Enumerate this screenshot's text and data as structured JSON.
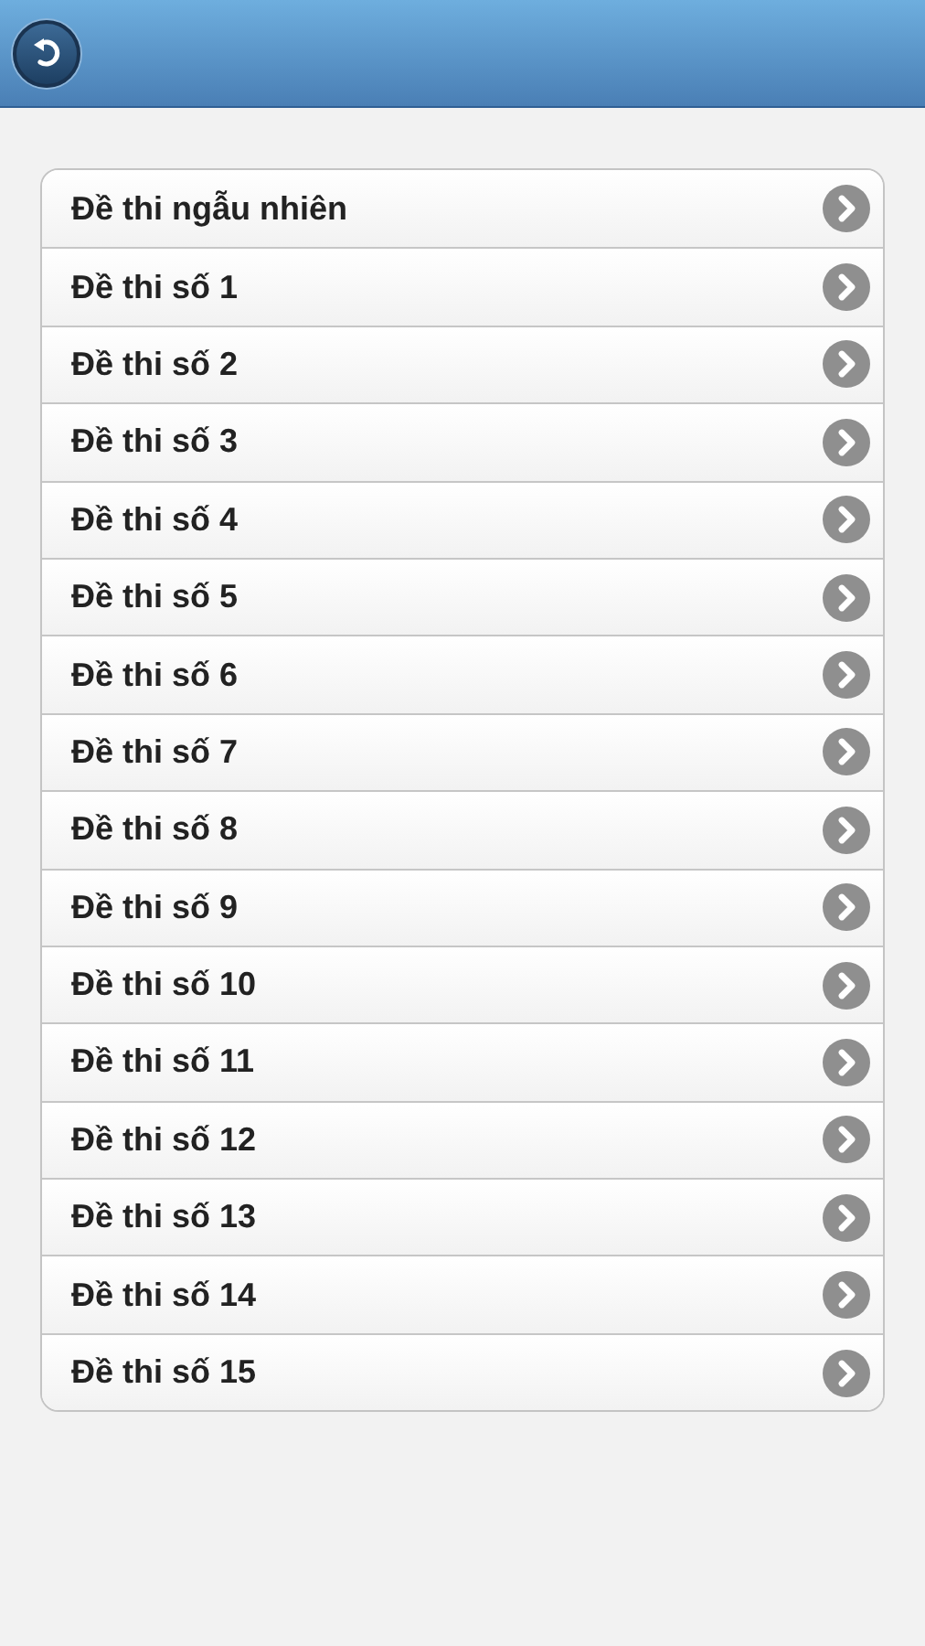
{
  "items": [
    {
      "label": "Đề thi ngẫu nhiên"
    },
    {
      "label": "Đề thi số 1"
    },
    {
      "label": "Đề thi số 2"
    },
    {
      "label": "Đề thi số 3"
    },
    {
      "label": "Đề thi số 4"
    },
    {
      "label": "Đề thi số 5"
    },
    {
      "label": "Đề thi số 6"
    },
    {
      "label": "Đề thi số 7"
    },
    {
      "label": "Đề thi số 8"
    },
    {
      "label": "Đề thi số 9"
    },
    {
      "label": "Đề thi số 10"
    },
    {
      "label": "Đề thi số 11"
    },
    {
      "label": "Đề thi số 12"
    },
    {
      "label": "Đề thi số 13"
    },
    {
      "label": "Đề thi số 14"
    },
    {
      "label": "Đề thi số 15"
    }
  ]
}
